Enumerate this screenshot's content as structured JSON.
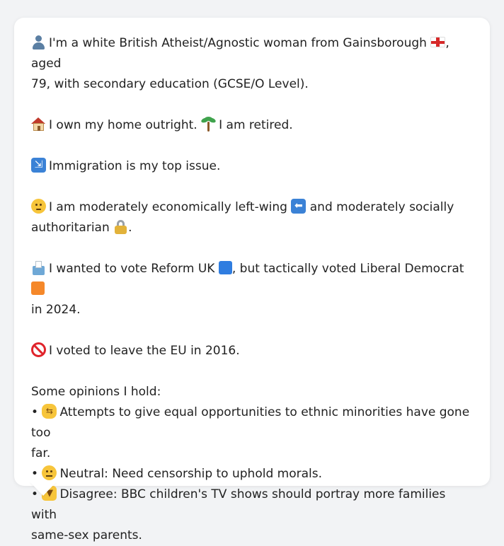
{
  "profile": {
    "identity_line": "I'm a white British Atheist/Agnostic woman from Gainsborough",
    "identity_line_after_flag": ", aged",
    "identity_line_2": "79, with secondary education (GCSE/O Level).",
    "home_text": "I own my home outright.",
    "retired_text": "I am retired.",
    "top_issue_text": "Immigration is my top issue.",
    "economic_text": "I am moderately economically left-wing",
    "social_text": "and moderately socially",
    "social_text_2": "authoritarian",
    "social_text_end": ".",
    "vote_text_1": "I wanted to vote Reform UK",
    "vote_text_2": ", but tactically voted Liberal Democrat",
    "vote_text_3": "in 2024.",
    "eu_text": "I voted to leave the EU in 2016.",
    "opinions_heading": "Some opinions I hold:",
    "opinions": [
      {
        "bullet": "•",
        "line_1": "Attempts to give equal opportunities to ethnic minorities have gone too",
        "line_2": "far."
      },
      {
        "bullet": "•",
        "line_1": "Neutral: Need censorship to uphold morals.",
        "line_2": ""
      },
      {
        "bullet": "•",
        "line_1": "Disagree: BBC children's TV shows should portray more families with",
        "line_2": "same-sex parents."
      }
    ]
  },
  "icons": {
    "person": "person-silhouette-icon",
    "flag": "england-flag-icon",
    "house": "house-icon",
    "palm": "palm-tree-icon",
    "immigration": "passport-control-icon",
    "thinking": "thinking-face-icon",
    "left_arrow": "left-arrow-icon",
    "lock": "lock-icon",
    "ballot": "ballot-box-icon",
    "blue_square": "blue-square-icon",
    "orange_square": "orange-square-icon",
    "prohibited": "prohibited-icon",
    "handshake": "handshake-icon",
    "neutral": "neutral-face-icon",
    "thumbs_down": "thumbs-down-icon"
  },
  "colors": {
    "reform_blue": "#2f7de0",
    "libdem_orange": "#f5882a",
    "bubble_bg": "#ffffff",
    "page_bg": "#f2f3f5",
    "text": "#222222"
  }
}
